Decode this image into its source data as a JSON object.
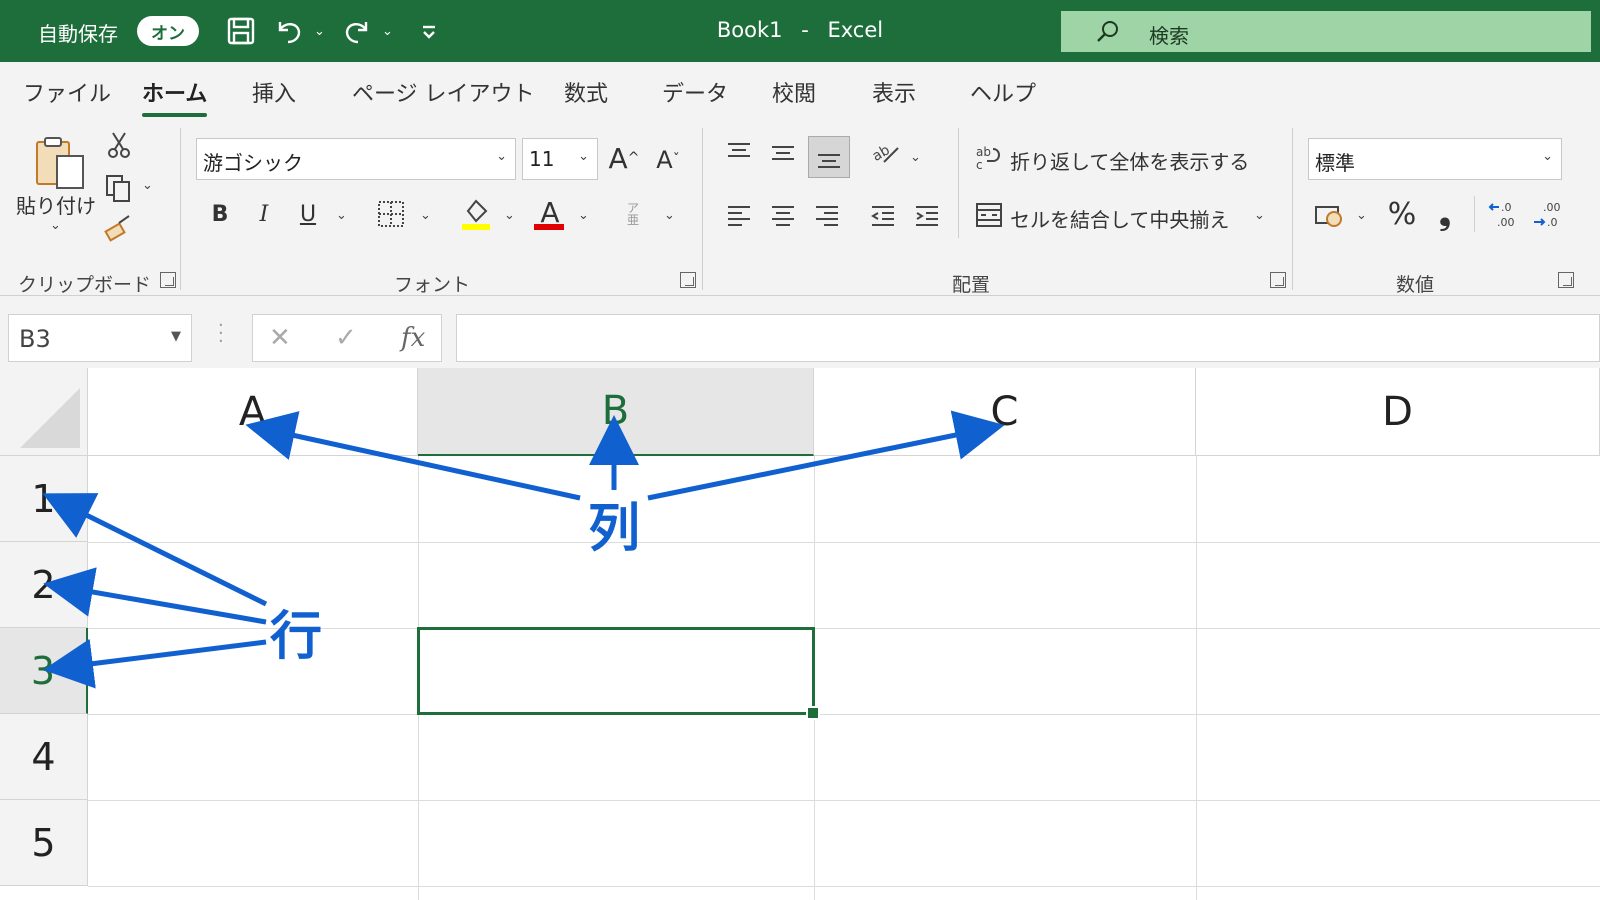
{
  "titlebar": {
    "autosave_label": "自動保存",
    "autosave_state": "オン",
    "doc_name": "Book1",
    "separator": "-",
    "app_name": "Excel",
    "search_placeholder": "検索",
    "bg_color": "#1e6e3c"
  },
  "tabs": [
    {
      "label": "ファイル",
      "active": false
    },
    {
      "label": "ホーム",
      "active": true
    },
    {
      "label": "挿入",
      "active": false
    },
    {
      "label": "ページ レイアウト",
      "active": false
    },
    {
      "label": "数式",
      "active": false
    },
    {
      "label": "データ",
      "active": false
    },
    {
      "label": "校閲",
      "active": false
    },
    {
      "label": "表示",
      "active": false
    },
    {
      "label": "ヘルプ",
      "active": false
    }
  ],
  "ribbon": {
    "clipboard": {
      "paste_label": "貼り付け",
      "group_label": "クリップボード"
    },
    "font": {
      "font_name": "游ゴシック",
      "font_size": "11",
      "bold": "B",
      "italic": "I",
      "underline": "U",
      "font_color_glyph": "A",
      "grow_glyph": "A",
      "shrink_glyph": "A",
      "group_label": "フォント",
      "highlight_color": "#ffff00",
      "font_color": "#e00000"
    },
    "alignment": {
      "wrap_text": "折り返して全体を表示する",
      "merge_center": "セルを結合して中央揃え",
      "group_label": "配置"
    },
    "number": {
      "format": "標準",
      "percent": "%",
      "comma": "❟",
      "group_label": "数値"
    }
  },
  "formula_bar": {
    "name_box": "B3",
    "cancel": "✕",
    "enter": "✓",
    "fx": "fx",
    "formula_value": ""
  },
  "sheet": {
    "columns": [
      "A",
      "B",
      "C",
      "D"
    ],
    "rows": [
      "1",
      "2",
      "3",
      "4",
      "5"
    ],
    "selected_cell": "B3",
    "selected_column": "B",
    "selected_row": "3",
    "accent_color": "#1e6e3c"
  },
  "annotations": {
    "column_label": "列",
    "row_label": "行",
    "arrow_color": "#1060d0"
  }
}
